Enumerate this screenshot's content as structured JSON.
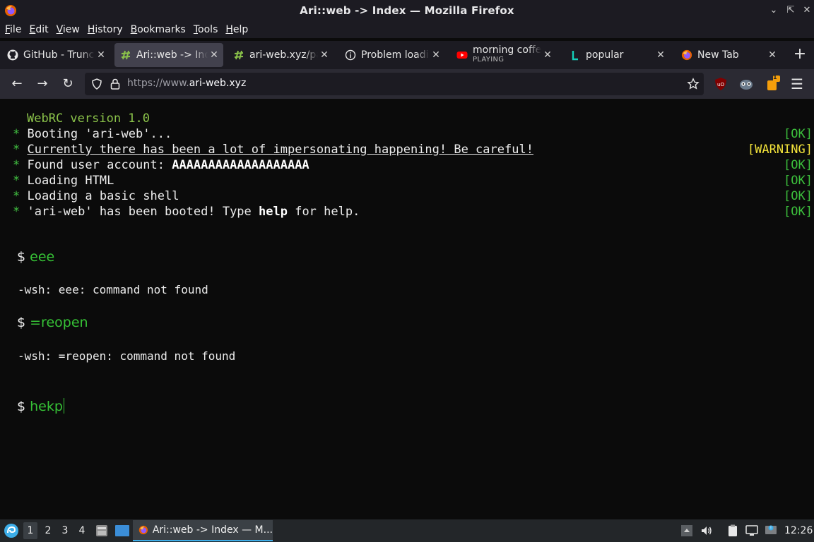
{
  "window": {
    "title": "Ari::web -> Index — Mozilla Firefox",
    "controls": [
      "minimize",
      "maximize",
      "close"
    ]
  },
  "menu": [
    "File",
    "Edit",
    "View",
    "History",
    "Bookmarks",
    "Tools",
    "Help"
  ],
  "tabs": [
    {
      "label": "GitHub - Truncat",
      "icon": "github-icon",
      "active": false
    },
    {
      "label": "Ari::web -> Index",
      "icon": "ari-web-icon",
      "active": true
    },
    {
      "label": "ari-web.xyz/page",
      "icon": "ari-web-icon",
      "active": false
    },
    {
      "label": "Problem loading",
      "icon": "info-icon",
      "active": false
    },
    {
      "label": "morning coffee",
      "sublabel": "PLAYING",
      "icon": "youtube-icon",
      "active": false
    },
    {
      "label": "popular",
      "icon": "lemmy-icon",
      "active": false
    },
    {
      "label": "New Tab",
      "icon": "firefox-icon",
      "active": false
    }
  ],
  "navbar": {
    "url_scheme": "https://www.",
    "url_host": "ari-web.xyz",
    "extension_badge": "1"
  },
  "terminal": {
    "boot_title": "WebRC version 1.0",
    "boot_lines": [
      {
        "bullet": "*",
        "text": "Booting 'ari-web'...",
        "status": "[OK]"
      },
      {
        "bullet": "*",
        "text": "Currently there has been a lot of impersonating happening! Be careful!",
        "status": "[WARNING]"
      },
      {
        "bullet": "*",
        "text_prefix": "Found user account: ",
        "text_bold": "AAAAAAAAAAAAAAAAAAA",
        "status": "[OK]"
      },
      {
        "bullet": "*",
        "text": "Loading HTML",
        "status": "[OK]"
      },
      {
        "bullet": "*",
        "text": "Loading a basic shell",
        "status": "[OK]"
      },
      {
        "bullet": "*",
        "text_prefix": "'ari-web' has been booted! Type ",
        "text_bold": "help",
        "text_suffix": " for help.",
        "status": "[OK]"
      }
    ],
    "prompt_symbol": "$",
    "history": [
      {
        "command": "eee",
        "output": "-wsh: eee: command not found"
      },
      {
        "command": "=reopen",
        "output": "-wsh: =reopen: command not found"
      }
    ],
    "current_input": "hekp"
  },
  "taskbar": {
    "workspaces": [
      "1",
      "2",
      "3",
      "4"
    ],
    "active_workspace": "1",
    "window_label": "Ari::web -> Index — M...",
    "clock": "12:26"
  },
  "colors": {
    "terminal_bg": "#0b0b0b",
    "prompt_green": "#36c236",
    "ok_green": "#3cbf3c",
    "warning_yellow": "#f2e23a",
    "taskbar_accent": "#3daee9"
  }
}
